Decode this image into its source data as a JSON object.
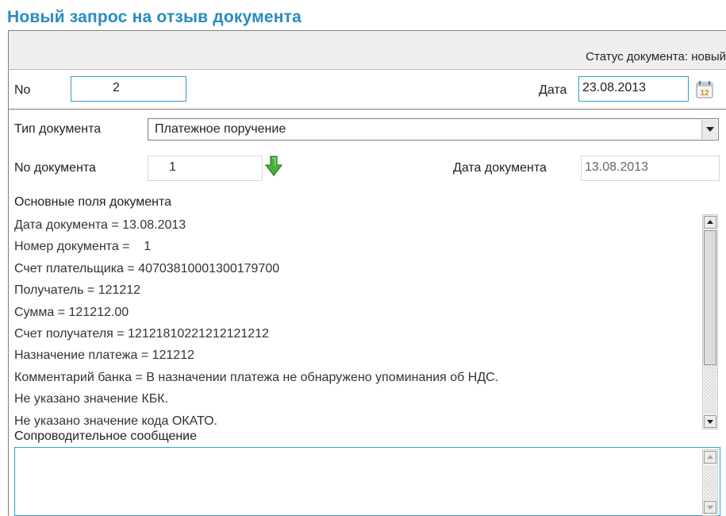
{
  "page": {
    "title": "Новый запрос на отзыв документа",
    "status": "Статус документа: новый"
  },
  "request": {
    "no_label": "No",
    "no_value": "2",
    "date_label": "Дата",
    "date_value": "23.08.2013",
    "calendar_icon": "calendar-icon",
    "calendar_icon_text": "12"
  },
  "document": {
    "type_label": "Тип документа",
    "type_value": "Платежное поручение",
    "number_label": "No документа",
    "number_value": "1",
    "fetch_icon": "green-down-arrow-icon",
    "date_label": "Дата документа",
    "date_value": "13.08.2013"
  },
  "main_fields": {
    "label": "Основные поля документа",
    "lines": [
      "Дата документа = 13.08.2013",
      "Номер документа =    1",
      "Счет плательщика = 40703810001300179700",
      "Получатель = 121212",
      "Сумма = 121212.00",
      "Счет получателя = 12121810221212121212",
      "Назначение платежа = 121212",
      "Комментарий банка = В назначении платежа не обнаружено упоминания об НДС.",
      "Не указано значение КБК.",
      "Не указано значение кода ОКАТО."
    ]
  },
  "message": {
    "label": "Сопроводительное сообщение",
    "value": ""
  },
  "colors": {
    "title": "#2a8bc0",
    "field_border": "#2a9fd6",
    "arrow": "#43a33a",
    "status_bar": "#efefef"
  }
}
